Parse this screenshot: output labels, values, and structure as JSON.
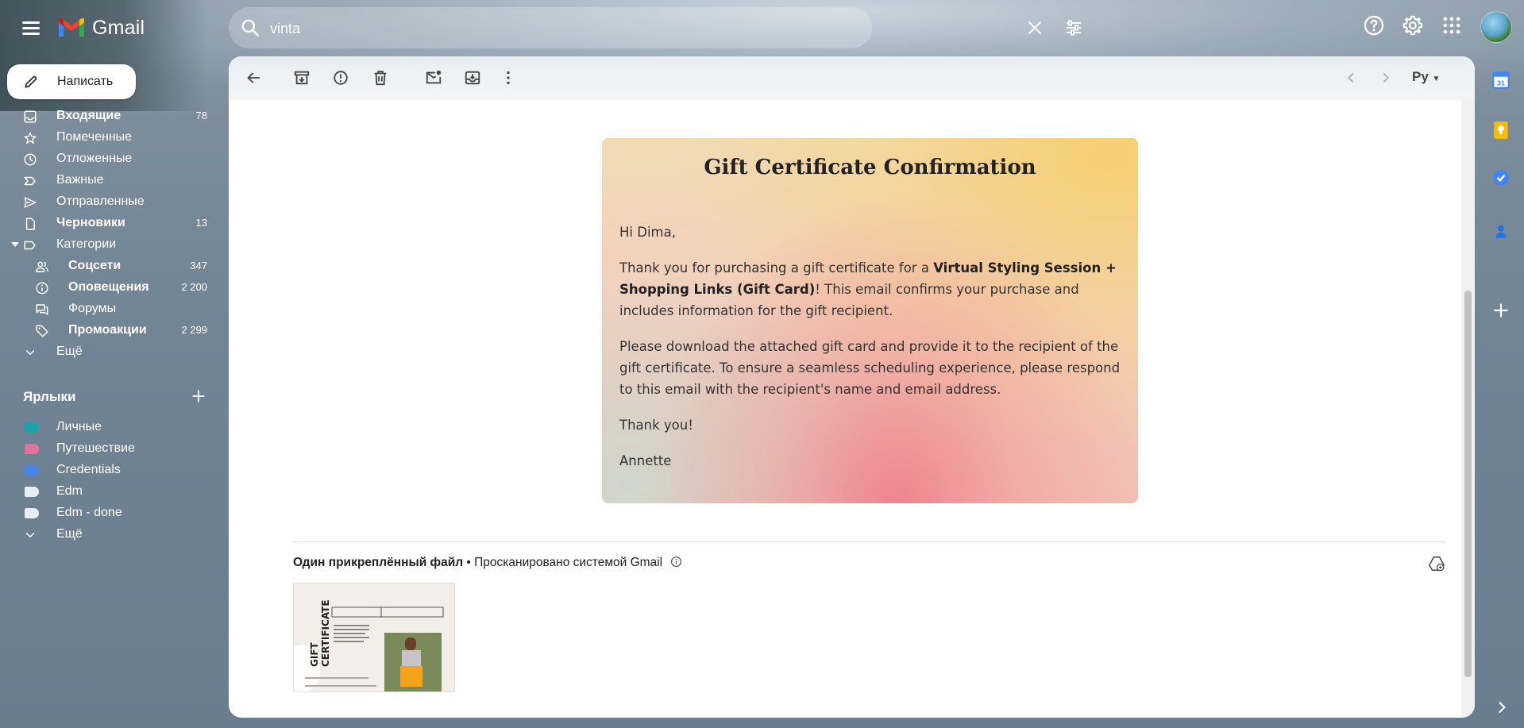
{
  "app": {
    "name": "Gmail"
  },
  "search": {
    "value": "vinta"
  },
  "compose": {
    "label": "Написать"
  },
  "nav": [
    {
      "id": "inbox",
      "label": "Входящие",
      "count": "78",
      "bold": true,
      "icon": "inbox-icon"
    },
    {
      "id": "starred",
      "label": "Помеченные",
      "count": "",
      "bold": false,
      "icon": "star-icon"
    },
    {
      "id": "snoozed",
      "label": "Отложенные",
      "count": "",
      "bold": false,
      "icon": "clock-icon"
    },
    {
      "id": "important",
      "label": "Важные",
      "count": "",
      "bold": false,
      "icon": "important-icon"
    },
    {
      "id": "sent",
      "label": "Отправленные",
      "count": "",
      "bold": false,
      "icon": "send-icon"
    },
    {
      "id": "drafts",
      "label": "Черновики",
      "count": "13",
      "bold": true,
      "icon": "draft-icon"
    },
    {
      "id": "categories",
      "label": "Категории",
      "count": "",
      "bold": false,
      "icon": "label-icon"
    },
    {
      "id": "social",
      "label": "Соцсети",
      "count": "347",
      "bold": true,
      "icon": "people-icon"
    },
    {
      "id": "updates",
      "label": "Оповещения",
      "count": "2 200",
      "bold": true,
      "icon": "info-icon"
    },
    {
      "id": "forums",
      "label": "Форумы",
      "count": "",
      "bold": false,
      "icon": "forum-icon"
    },
    {
      "id": "promotions",
      "label": "Промоакции",
      "count": "2 299",
      "bold": true,
      "icon": "tag-icon"
    },
    {
      "id": "more",
      "label": "Ещё",
      "count": "",
      "bold": false,
      "icon": "chevron-down-icon"
    }
  ],
  "labels_section": {
    "title": "Ярлыки",
    "items": [
      {
        "label": "Личные",
        "color": "#1aa1b0"
      },
      {
        "label": "Путешествие",
        "color": "#e8709a"
      },
      {
        "label": "Credentials",
        "color": "#4a86e8"
      },
      {
        "label": "Edm",
        "color": "#e8edf1"
      },
      {
        "label": "Edm - done",
        "color": "#e8edf1"
      }
    ],
    "more": "Ещё"
  },
  "toolbar": {
    "language": "Ру"
  },
  "email": {
    "title": "Gift Certificate Confirmation",
    "greeting": "Hi Dima,",
    "p1_a": "Thank you for purchasing a gift certificate for a ",
    "p1_bold": "Virtual Styling Session + Shopping Links (Gift Card)",
    "p1_b": "! This email confirms your purchase and includes information for the gift recipient.",
    "p2": "Please download the attached gift card and provide it to the recipient of the gift certificate. To ensure a seamless scheduling experience, please respond to this email with the recipient's name and email address.",
    "thanks": "Thank you!",
    "signature": "Annette"
  },
  "attachments": {
    "heading": "Один прикреплённый файл",
    "scan_note": " • Просканировано системой Gmail",
    "thumb_title_1": "GIFT",
    "thumb_title_2": "CERTIFICATE"
  }
}
